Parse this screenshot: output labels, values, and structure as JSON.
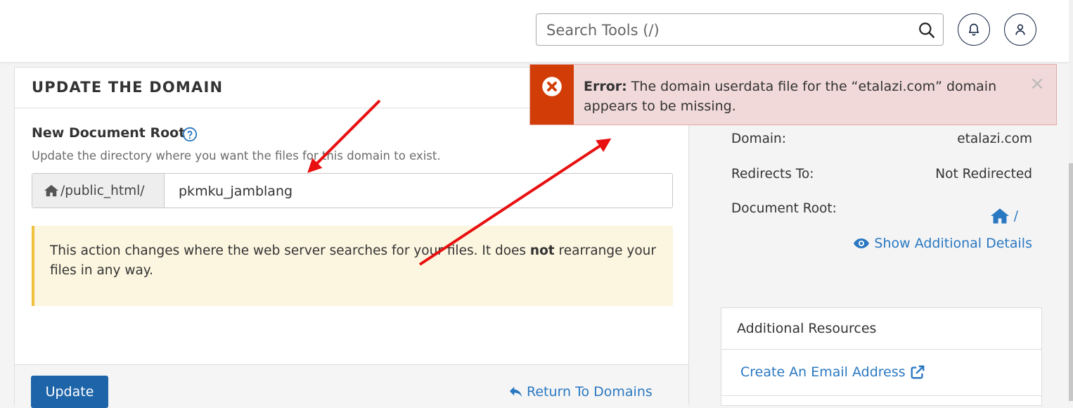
{
  "header": {
    "search_placeholder": "Search Tools (/)",
    "search_icon": "search-icon",
    "notifications_icon": "bell-icon",
    "user_icon": "user-icon"
  },
  "panel": {
    "title": "UPDATE THE DOMAIN",
    "field_label": "New Document Root",
    "help_icon": "question-circle-icon",
    "field_help": "Update the directory where you want the files for this domain to exist.",
    "path_prefix": "/public_html/",
    "home_icon": "home-icon",
    "path_value": "pkmku_jamblang",
    "warning_before": "This action changes where the web server searches for your files. It does ",
    "warning_bold": "not",
    "warning_after": " rearrange your files in any way.",
    "update_label": "Update",
    "return_label": "Return To Domains",
    "return_icon": "reply-icon"
  },
  "side": {
    "domain_key": "Domain:",
    "domain_value": "etalazi.com",
    "redirects_key": "Redirects To:",
    "redirects_value": "Not Redirected",
    "docroot_key": "Document Root:",
    "docroot_value": "/",
    "show_details": "Show Additional Details",
    "eye_icon": "eye-icon"
  },
  "resources": {
    "title": "Additional Resources",
    "link1": "Create An Email Address",
    "external_icon": "external-link-icon"
  },
  "alert": {
    "label": "Error:",
    "message": " The domain userdata file for the “etalazi.com” domain appears to be missing.",
    "close": "×",
    "icon": "times-circle-icon"
  },
  "colors": {
    "primary": "#1e64a8",
    "link": "#2a78c2",
    "error_icon_bg": "#d23c07",
    "error_bg": "#f2d9d9",
    "warning_bg": "#fcf6e0",
    "warning_border": "#f0c040",
    "annotation_arrow": "#e81010"
  }
}
